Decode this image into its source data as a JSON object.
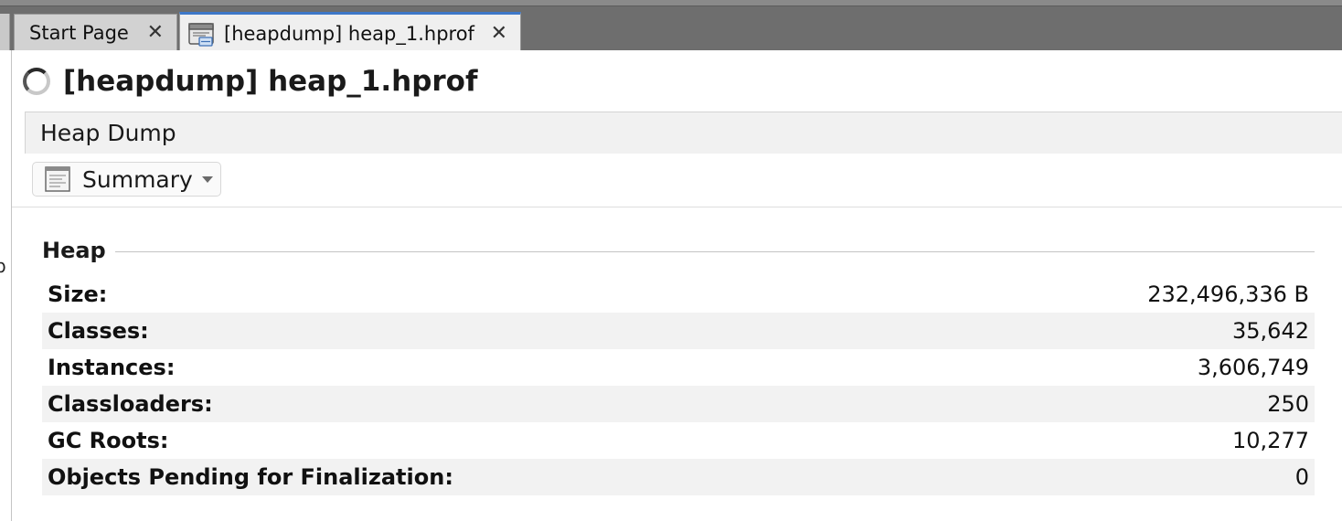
{
  "tabs": {
    "start_page": {
      "label": "Start Page",
      "close": "✕"
    },
    "heapdump": {
      "label": "[heapdump] heap_1.hprof",
      "close": "✕"
    }
  },
  "document": {
    "title": "[heapdump] heap_1.hprof"
  },
  "section_bar": {
    "label": "Heap Dump"
  },
  "view_selector": {
    "selected": "Summary"
  },
  "heap": {
    "title": "Heap",
    "rows": [
      {
        "label": "Size:",
        "value": "232,496,336 B"
      },
      {
        "label": "Classes:",
        "value": "35,642"
      },
      {
        "label": "Instances:",
        "value": "3,606,749"
      },
      {
        "label": "Classloaders:",
        "value": "250"
      },
      {
        "label": "GC Roots:",
        "value": "10,277"
      },
      {
        "label": "Objects Pending for Finalization:",
        "value": "0"
      }
    ]
  },
  "left_edge": {
    "glyph": "p"
  },
  "colors": {
    "tab_active_accent": "#3d78c8",
    "tabbar_background": "#6e6e6e",
    "row_alt": "#f2f2f2"
  },
  "icons": {
    "tab": "heapdump-file-icon",
    "title": "loading-spinner-icon",
    "view": "summary-page-icon"
  }
}
